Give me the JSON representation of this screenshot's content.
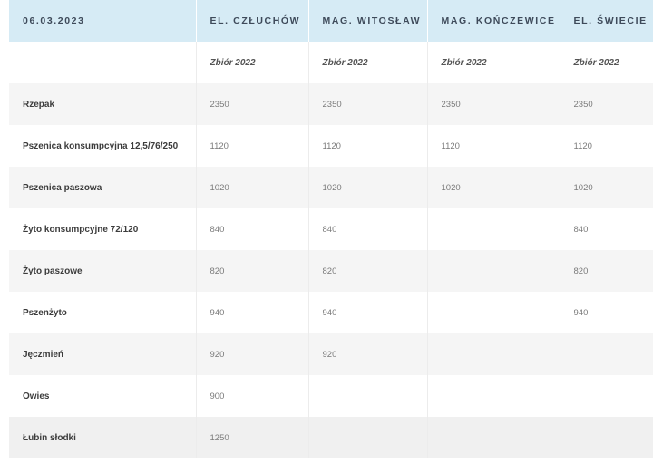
{
  "table": {
    "date": "06.03.2023",
    "columns": [
      "EL. CZŁUCHÓW",
      "MAG. WITOSŁAW",
      "MAG. KOŃCZEWICE",
      "EL. ŚWIECIE"
    ],
    "season": [
      "Zbiór 2022",
      "Zbiór 2022",
      "Zbiór 2022",
      "Zbiór 2022"
    ],
    "rows": [
      {
        "product": "Rzepak",
        "prices": [
          "2350",
          "2350",
          "2350",
          "2350"
        ]
      },
      {
        "product": "Pszenica konsumpcyjna 12,5/76/250",
        "prices": [
          "1120",
          "1120",
          "1120",
          "1120"
        ]
      },
      {
        "product": "Pszenica paszowa",
        "prices": [
          "1020",
          "1020",
          "1020",
          "1020"
        ]
      },
      {
        "product": "Żyto konsumpcyjne 72/120",
        "prices": [
          "840",
          "840",
          "",
          "840"
        ]
      },
      {
        "product": "Żyto paszowe",
        "prices": [
          "820",
          "820",
          "",
          "820"
        ]
      },
      {
        "product": "Pszenżyto",
        "prices": [
          "940",
          "940",
          "",
          "940"
        ]
      },
      {
        "product": "Jęczmień",
        "prices": [
          "920",
          "920",
          "",
          ""
        ]
      },
      {
        "product": "Owies",
        "prices": [
          "900",
          "",
          "",
          ""
        ]
      },
      {
        "product": "Łubin słodki",
        "prices": [
          "1250",
          "",
          "",
          ""
        ]
      }
    ]
  }
}
